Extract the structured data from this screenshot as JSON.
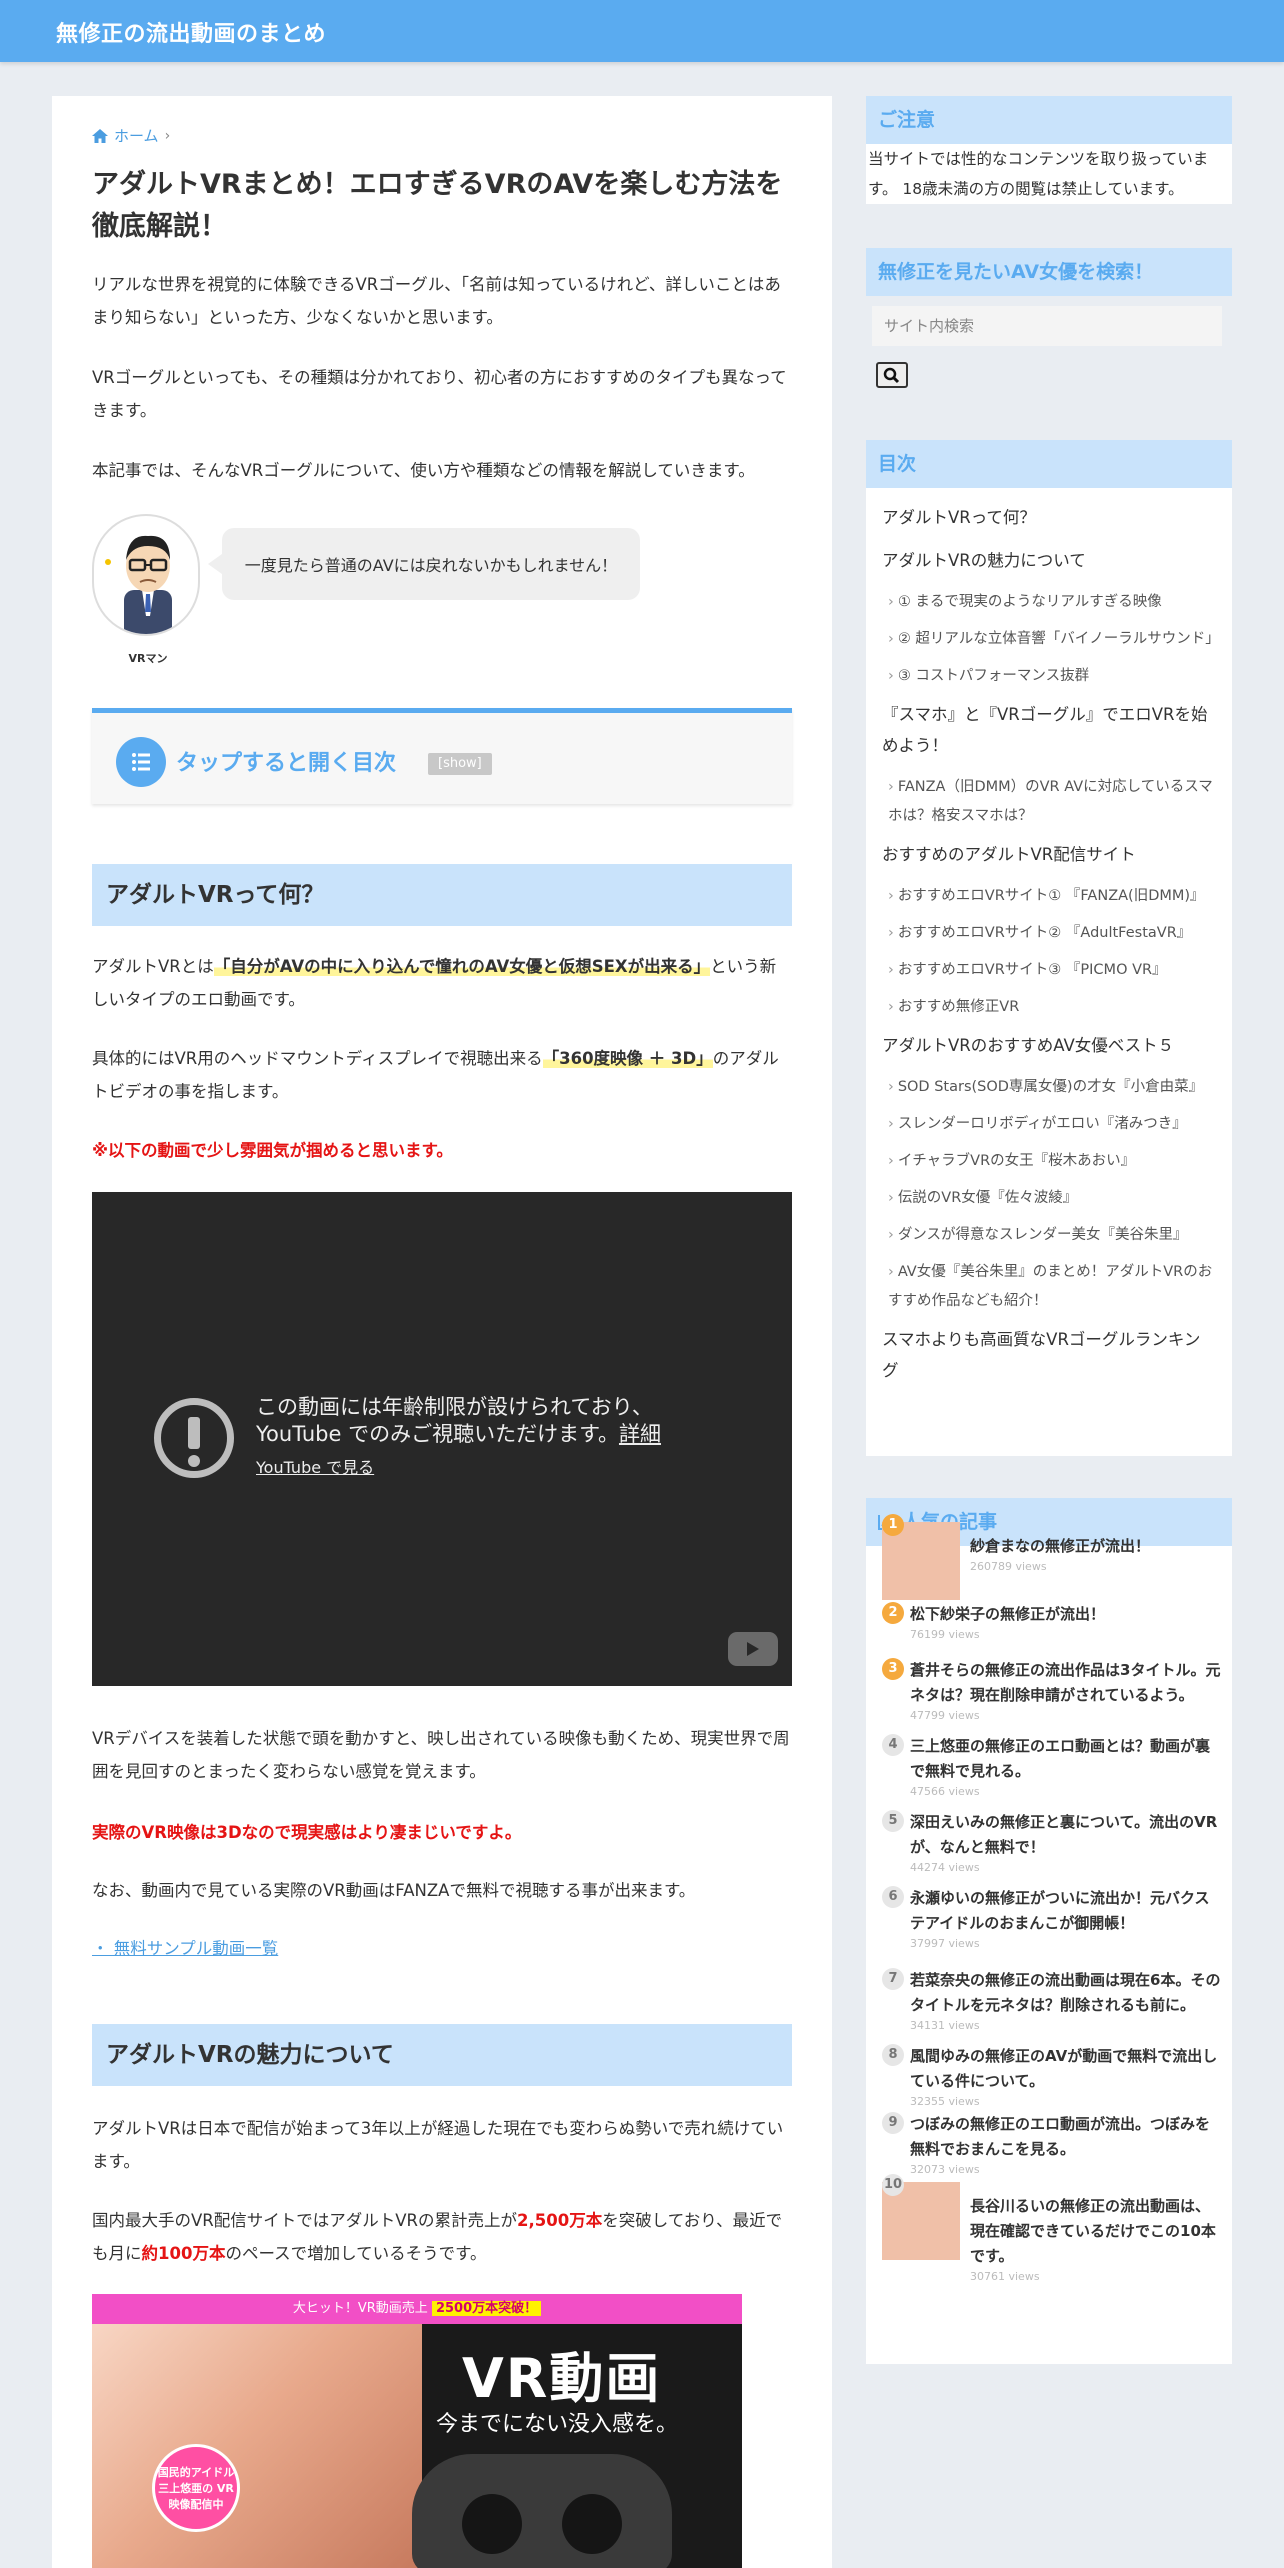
{
  "site": {
    "title": "無修正の流出動画のまとめ"
  },
  "breadcrumb": {
    "home": "ホーム",
    "sep": "›"
  },
  "article": {
    "title": "アダルトVRまとめ！エロすぎるVRのAVを楽しむ方法を徹底解説！",
    "intro1": "リアルな世界を視覚的に体験できるVRゴーグル、「名前は知っているけれど、詳しいことはあまり知らない」といった方、少なくないかと思います。",
    "intro2": "VRゴーグルといっても、その種類は分かれており、初心者の方におすすめのタイプも異なってきます。",
    "intro3": "本記事では、そんなVRゴーグルについて、使い方や種類などの情報を解説していきます。",
    "speaker_name": "VRマン",
    "speech": "一度見たら普通のAVには戻れないかもしれません！",
    "toc_title": "タップすると開く目次",
    "toc_show": "[show]",
    "h2_1": "アダルトVRって何？",
    "p1_a": "アダルトVRとは",
    "p1_mark": "「自分がAVの中に入り込んで憧れのAV女優と仮想SEXが出来る」",
    "p1_b": "という新しいタイプのエロ動画です。",
    "p2_a": "具体的にはVR用のヘッドマウントディスプレイで視聴出来る",
    "p2_mark": "「360度映像 ＋ 3D」",
    "p2_b": "のアダルトビデオの事を指します。",
    "red1": "※以下の動画で少し雰囲気が掴めると思います。",
    "video_msg1": "この動画には年齢制限が設けられており、",
    "video_msg2": "YouTube でのみご視聴いただけます。",
    "video_detail": "詳細",
    "video_watch": "YouTube で見る",
    "p3": "VRデバイスを装着した状態で頭を動かすと、映し出されている映像も動くため、現実世界で周囲を見回すのとまったく変わらない感覚を覚えます。",
    "red2": "実際のVR映像は3Dなので現実感はより凄まじいですよ。",
    "p4": "なお、動画内で見ている実際のVR動画はFANZAで無料で視聴する事が出来ます。",
    "sample_link": "・ 無料サンプル動画一覧",
    "h2_2": "アダルトVRの魅力について",
    "p5": "アダルトVRは日本で配信が始まって3年以上が経過した現在でも変わらぬ勢いで売れ続けています。",
    "p6_a": "国内最大手のVR配信サイトではアダルトVRの累計売上が",
    "p6_red1": "2,500万本",
    "p6_b": "を突破しており、最近でも月に",
    "p6_red2": "約100万本",
    "p6_c": "のペースで増加しているそうです。",
    "banner_top_a": "大ヒット！VR動画売上",
    "banner_top_hl": "2500万本突破！",
    "banner_title": "VR動画",
    "banner_sub": "今までにない没入感を。",
    "banner_badge": "国民的アイドル 三上悠亜の VR映像配信中"
  },
  "sidebar": {
    "notice_head": "ご注意",
    "notice_text": "当サイトでは性的なコンテンツを取り扱っています。 18歳未満の方の閲覧は禁止しています。",
    "search_head": "無修正を見たいAV女優を検索！",
    "search_placeholder": "サイト内検索",
    "toc_head": "目次",
    "toc": [
      {
        "level": 1,
        "text": "アダルトVRって何？"
      },
      {
        "level": 1,
        "text": "アダルトVRの魅力について"
      },
      {
        "level": 2,
        "text": "① まるで現実のようなリアルすぎる映像"
      },
      {
        "level": 2,
        "text": "② 超リアルな立体音響「バイノーラルサウンド」"
      },
      {
        "level": 2,
        "text": "③ コストパフォーマンス抜群"
      },
      {
        "level": 1,
        "text": "『スマホ』と『VRゴーグル』でエロVRを始めよう！"
      },
      {
        "level": 2,
        "text": "FANZA（旧DMM）のVR AVに対応しているスマホは？格安スマホは？"
      },
      {
        "level": 1,
        "text": "おすすめのアダルトVR配信サイト"
      },
      {
        "level": 2,
        "text": "おすすめエロVRサイト① 『FANZA(旧DMM)』"
      },
      {
        "level": 2,
        "text": "おすすめエロVRサイト② 『AdultFestaVR』"
      },
      {
        "level": 2,
        "text": "おすすめエロVRサイト③ 『PICMO VR』"
      },
      {
        "level": 2,
        "text": "おすすめ無修正VR"
      },
      {
        "level": 1,
        "text": "アダルトVRのおすすめAV女優ベスト５"
      },
      {
        "level": 2,
        "text": "SOD Stars(SOD専属女優)の才女『小倉由菜』"
      },
      {
        "level": 2,
        "text": "スレンダーロリボディがエロい『渚みつき』"
      },
      {
        "level": 2,
        "text": "イチャラブVRの女王『桜木あおい』"
      },
      {
        "level": 2,
        "text": "伝説のVR女優『佐々波綾』"
      },
      {
        "level": 2,
        "text": "ダンスが得意なスレンダー美女『美谷朱里』"
      },
      {
        "level": 2,
        "text": "AV女優『美谷朱里』のまとめ！アダルトVRのおすすめ作品なども紹介！"
      },
      {
        "level": 1,
        "text": "スマホよりも高画質なVRゴーグルランキング"
      }
    ],
    "popular_head": "人気の記事",
    "popular": [
      {
        "rank": "1",
        "title": "紗倉まなの無修正が流出！",
        "views": "260789 views"
      },
      {
        "rank": "2",
        "title": "松下紗栄子の無修正が流出！",
        "views": "76199 views"
      },
      {
        "rank": "3",
        "title": "蒼井そらの無修正の流出作品は3タイトル。元ネタは？現在削除申請がされているよう。",
        "views": "47799 views"
      },
      {
        "rank": "4",
        "title": "三上悠亜の無修正のエロ動画とは？動画が裏で無料で見れる。",
        "views": "47566 views"
      },
      {
        "rank": "5",
        "title": "深田えいみの無修正と裏について。流出のVRが、なんと無料で！",
        "views": "44274 views"
      },
      {
        "rank": "6",
        "title": "永瀬ゆいの無修正がついに流出か！元バクステアイドルのおまんこが御開帳！",
        "views": "37997 views"
      },
      {
        "rank": "7",
        "title": "若菜奈央の無修正の流出動画は現在6本。そのタイトルを元ネタは？削除されるも前に。",
        "views": "34131 views"
      },
      {
        "rank": "8",
        "title": "風間ゆみの無修正のAVが動画で無料で流出している件について。",
        "views": "32355 views"
      },
      {
        "rank": "9",
        "title": "つぼみの無修正のエロ動画が流出。つぼみを無料でおまんこを見る。",
        "views": "32073 views"
      },
      {
        "rank": "10",
        "title": "長谷川るいの無修正の流出動画は、現在確認できているだけでこの10本です。",
        "views": "30761 views"
      }
    ]
  },
  "colors": {
    "accent": "#5aabf0",
    "heading_bg": "#c9e3fb",
    "red": "#e51414",
    "marker": "#fff59b"
  }
}
